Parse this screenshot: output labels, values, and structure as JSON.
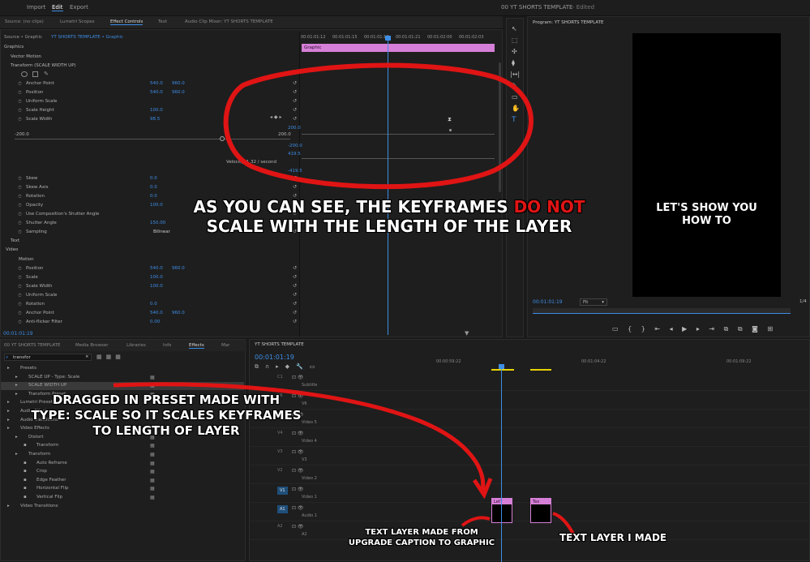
{
  "window_title": "00 YT SHORTS TEMPLATE",
  "window_status": "- Edited",
  "menu": [
    "Import",
    "Edit",
    "Export"
  ],
  "source_tabs": [
    "Source: (no clips)",
    "Lumetri Scopes",
    "Effect Controls",
    "Text",
    "Audio Clip Mixer: YT SHORTS TEMPLATE"
  ],
  "effect_controls": {
    "source_label": "Source • Graphic",
    "sequence_label": "YT SHORTS TEMPLATE • Graphic",
    "timecodes": [
      "00:01:01:12",
      "00:01:01:15",
      "00:01:01:18",
      "00:01:01:21",
      "00:01:02:00",
      "00:01:02:03"
    ],
    "graphic_bar": "Graphic",
    "graphics_header": "Graphics",
    "vector_motion": "Vector Motion",
    "transform": "Transform (SCALE WIDTH UP)",
    "props": [
      {
        "label": "Anchor Point",
        "v1": "540.0",
        "v2": "960.0"
      },
      {
        "label": "Position",
        "v1": "540.0",
        "v2": "960.0"
      },
      {
        "label": "Uniform Scale"
      },
      {
        "label": "Scale Height",
        "v1": "100.0"
      },
      {
        "label": "Scale Width",
        "v1": "98.5"
      }
    ],
    "graph": {
      "left": "-200.0",
      "right": "200.0",
      "g1": "200.0",
      "g2": "-200.0",
      "g3": "419.5",
      "g4": "-419.5",
      "velocity": "Velocity: 1.32 / second"
    },
    "props2": [
      {
        "label": "Skew",
        "v1": "0.0"
      },
      {
        "label": "Skew Axis",
        "v1": "0.0"
      },
      {
        "label": "Rotation",
        "v1": "0.0"
      },
      {
        "label": "Opacity",
        "v1": "100.0"
      },
      {
        "label": "Use Composition's Shutter Angle"
      },
      {
        "label": "Shutter Angle",
        "v1": "150.00"
      },
      {
        "label": "Sampling",
        "v1": "Bilinear"
      }
    ],
    "text": "Text",
    "video": "Video",
    "motion": "Motion",
    "props3": [
      {
        "label": "Position",
        "v1": "540.0",
        "v2": "960.0"
      },
      {
        "label": "Scale",
        "v1": "100.0"
      },
      {
        "label": "Scale Width",
        "v1": "100.0"
      },
      {
        "label": "Uniform Scale"
      },
      {
        "label": "Rotation",
        "v1": "0.0"
      },
      {
        "label": "Anchor Point",
        "v1": "540.0",
        "v2": "960.0"
      },
      {
        "label": "Anti-flicker Filter",
        "v1": "0.00"
      }
    ],
    "current_time": "00:01:01:19"
  },
  "program": {
    "title": "Program: YT SHORTS TEMPLATE",
    "caption_line1": "LET'S SHOW YOU",
    "caption_line2": "HOW TO",
    "timecode": "00:01:01:19",
    "fit": "Fit",
    "page": "1/4"
  },
  "project_tabs": [
    "00 YT SHORTS TEMPLATE",
    "Media Browser",
    "Libraries",
    "Info",
    "Effects",
    "Mar"
  ],
  "effects": {
    "search": "transfor",
    "items": [
      {
        "label": "Presets",
        "indent": 0
      },
      {
        "label": "SCALE UP - Type: Scale",
        "indent": 1
      },
      {
        "label": "SCALE WIDTH UP",
        "indent": 1
      },
      {
        "label": "Transform Preset",
        "indent": 1
      },
      {
        "label": "Lumetri Presets",
        "indent": 0
      },
      {
        "label": "Audio Effects",
        "indent": 0
      },
      {
        "label": "Audio Transitions",
        "indent": 0
      },
      {
        "label": "Video Effects",
        "indent": 0
      },
      {
        "label": "Distort",
        "indent": 1
      },
      {
        "label": "Transform",
        "indent": 2
      },
      {
        "label": "Transform",
        "indent": 1
      },
      {
        "label": "Auto Reframe",
        "indent": 2
      },
      {
        "label": "Crop",
        "indent": 2
      },
      {
        "label": "Edge Feather",
        "indent": 2
      },
      {
        "label": "Horizontal Flip",
        "indent": 2
      },
      {
        "label": "Vertical Flip",
        "indent": 2
      },
      {
        "label": "Video Transitions",
        "indent": 0
      }
    ]
  },
  "timeline": {
    "title": "YT SHORTS TEMPLATE",
    "timecode": "00:01:01:19",
    "ruler": [
      "00:00:59:22",
      "00:01:04:22",
      "00:01:09:22"
    ],
    "tracks": [
      "Subtitle",
      "V6",
      "Video 5",
      "Video 4",
      "V3",
      "Video 2",
      "Video 1",
      "Audio 1",
      "A2"
    ],
    "track_ids": [
      "C1",
      "V6",
      "V5",
      "V4",
      "V3",
      "V2",
      "V1",
      "A1",
      "A2"
    ],
    "clip1_label": "Let'",
    "clip2_label": "Tex"
  },
  "annotations": {
    "main_line1_a": "AS YOU CAN SEE, THE KEYFRAMES ",
    "main_line1_b": "DO NOT",
    "main_line2": "SCALE WITH THE LENGTH OF THE LAYER",
    "preset_line1": "DRAGGED IN PRESET MADE WITH",
    "preset_line2": "TYPE: SCALE SO IT SCALES KEYFRAMES",
    "preset_line3": "TO LENGTH OF LAYER",
    "upgrade_line1": "TEXT LAYER MADE FROM",
    "upgrade_line2": "UPGRADE CAPTION TO GRAPHIC",
    "made_label": "TEXT LAYER I MADE"
  },
  "colors": {
    "accent_red": "#e01414",
    "clip_pink": "#d67fd8",
    "timecode_blue": "#3d8ee6",
    "playhead": "#3d8ee6"
  }
}
